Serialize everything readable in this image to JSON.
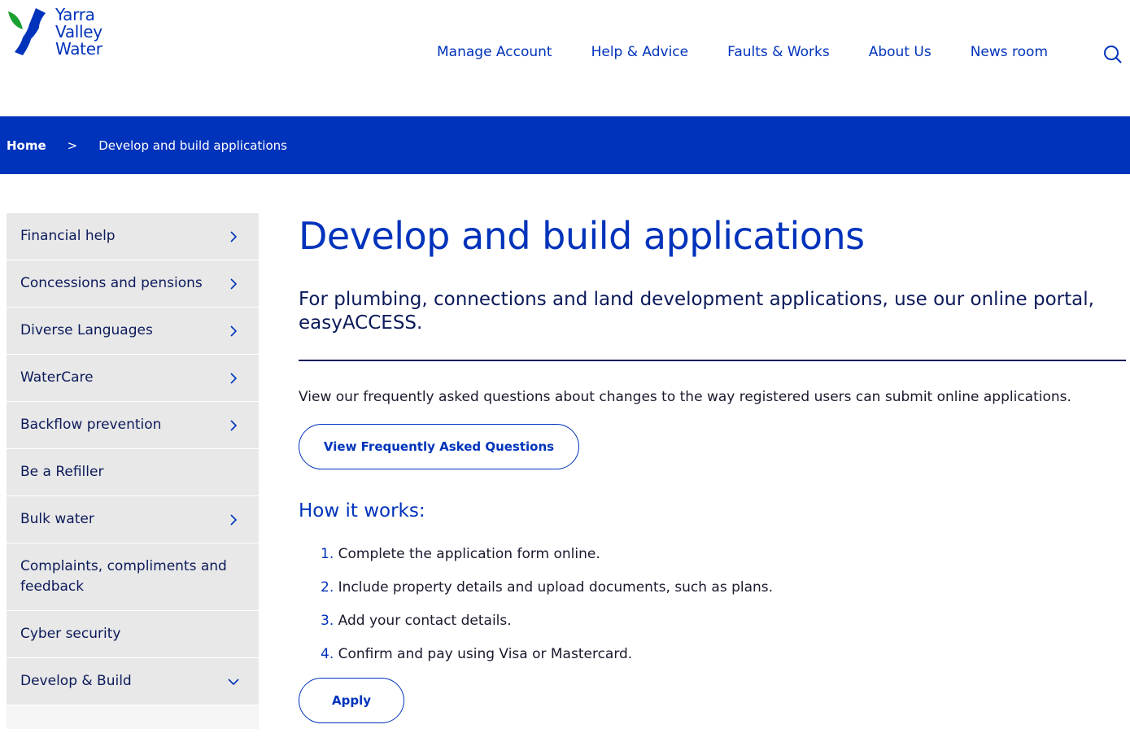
{
  "logo": {
    "line1": "Yarra",
    "line2": "Valley",
    "line3": "Water"
  },
  "nav": [
    "Manage Account",
    "Help & Advice",
    "Faults & Works",
    "About Us",
    "News room"
  ],
  "breadcrumb": {
    "home": "Home",
    "sep": ">",
    "current": "Develop and build applications"
  },
  "sidebar": [
    {
      "label": "Financial help",
      "chev": "right"
    },
    {
      "label": "Concessions and pensions",
      "chev": "right"
    },
    {
      "label": "Diverse Languages",
      "chev": "right"
    },
    {
      "label": "WaterCare",
      "chev": "right"
    },
    {
      "label": "Backflow prevention",
      "chev": "right"
    },
    {
      "label": "Be a Refiller",
      "chev": ""
    },
    {
      "label": "Bulk water",
      "chev": "right"
    },
    {
      "label": "Complaints, compliments and feedback",
      "chev": ""
    },
    {
      "label": "Cyber security",
      "chev": ""
    },
    {
      "label": "Develop & Build",
      "chev": "down"
    }
  ],
  "main": {
    "title": "Develop and build applications",
    "lead": "For plumbing, connections and land development applications, use our online portal, easyACCESS.",
    "faq_text": "View our frequently asked questions about changes to the way registered users can submit online applications.",
    "faq_button": "View Frequently Asked Questions",
    "how_title": "How it works:",
    "steps": [
      {
        "n": "1.",
        "t": "Complete the application form online."
      },
      {
        "n": "2.",
        "t": "Include property details and upload documents, such as plans."
      },
      {
        "n": "3.",
        "t": "Add your contact details."
      },
      {
        "n": "4.",
        "t": "Confirm and pay using Visa or Mastercard."
      }
    ],
    "apply": "Apply"
  }
}
